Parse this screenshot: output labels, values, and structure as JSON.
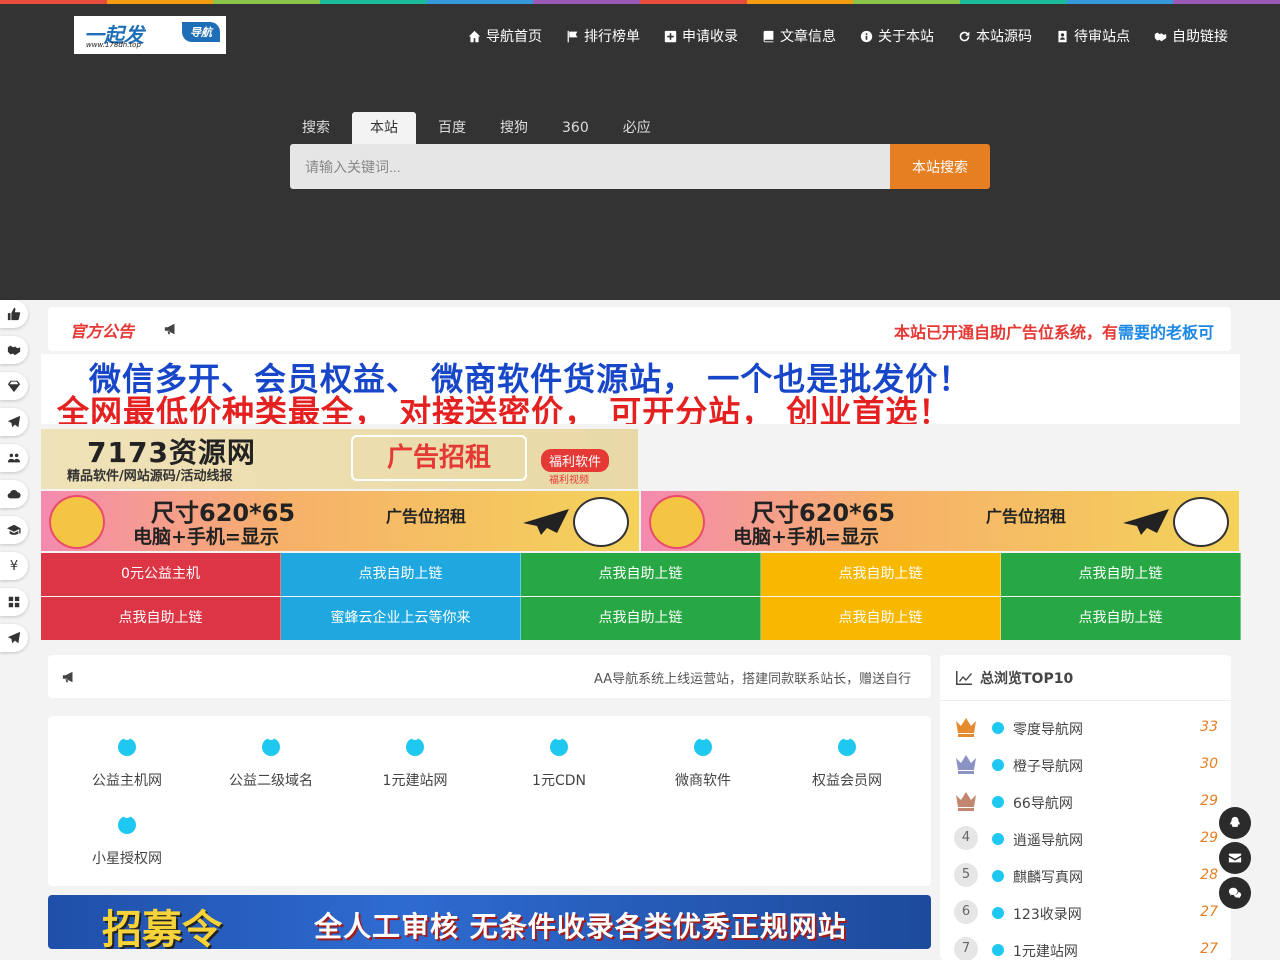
{
  "colors": {
    "rainbow": [
      "#e74c3c",
      "#f39c12",
      "#8bc34a",
      "#1abc9c",
      "#3498db",
      "#9b59b6",
      "#e74c3c",
      "#f39c12",
      "#8bc34a",
      "#1abc9c",
      "#3498db",
      "#9b59b6"
    ],
    "header_bg": "#333333",
    "accent": "#e67e22"
  },
  "logo": {
    "main": "一起发",
    "badge": "导航",
    "url": "www.178dh.top"
  },
  "nav": [
    {
      "label": "导航首页",
      "icon": "home-icon"
    },
    {
      "label": "排行榜单",
      "icon": "flag-icon"
    },
    {
      "label": "申请收录",
      "icon": "plus-square-icon"
    },
    {
      "label": "文章信息",
      "icon": "book-icon"
    },
    {
      "label": "关于本站",
      "icon": "info-icon"
    },
    {
      "label": "本站源码",
      "icon": "refresh-icon"
    },
    {
      "label": "待审站点",
      "icon": "user-card-icon"
    },
    {
      "label": "自助链接",
      "icon": "handshake-icon"
    }
  ],
  "search": {
    "tabs": [
      "搜索",
      "本站",
      "百度",
      "搜狗",
      "360",
      "必应"
    ],
    "active_tab": "本站",
    "placeholder": "请输入关键词...",
    "button": "本站搜索"
  },
  "sidebar": [
    "thumbs-up-icon",
    "handshake-icon",
    "diamond-icon",
    "paper-plane-icon",
    "users-icon",
    "cloud-icon",
    "graduation-cap-icon",
    "yen-icon",
    "grid-icon",
    "paper-plane-icon"
  ],
  "notice": {
    "title": "官方公告",
    "message_a": "本站已开通自助广告位系统，有",
    "message_b": "需要的老板可"
  },
  "ads": {
    "wide_line1": "微信多开、会员权益、 微商软件货源站， 一个也是批发价！",
    "wide_line2": "全网最低价种类最全， 对接送密价， 可开分站， 创业首选！",
    "res_title": "7173资源网",
    "res_sub": "精品软件/网站源码/活动线报",
    "res_rent": "广告招租",
    "res_tag1": "福利软件",
    "res_tag2": "福利视频",
    "size_text": "尺寸620*65",
    "device_text": "电脑+手机=显示",
    "rent_text": "广告位招租"
  },
  "link_grid": [
    {
      "label": "0元公益主机",
      "color": "red"
    },
    {
      "label": "点我自助上链",
      "color": "blue"
    },
    {
      "label": "点我自助上链",
      "color": "green"
    },
    {
      "label": "点我自助上链",
      "color": "yellow"
    },
    {
      "label": "点我自助上链",
      "color": "green"
    },
    {
      "label": "点我自助上链",
      "color": "red"
    },
    {
      "label": "蜜蜂云企业上云等你来",
      "color": "blue"
    },
    {
      "label": "点我自助上链",
      "color": "green"
    },
    {
      "label": "点我自助上链",
      "color": "yellow"
    },
    {
      "label": "点我自助上链",
      "color": "green"
    }
  ],
  "notice2": {
    "message": "AA导航系统上线运营站，搭建同款联系站长，赠送自行"
  },
  "sites": [
    "公益主机网",
    "公益二级域名",
    "1元建站网",
    "1元CDN",
    "微商软件",
    "权益会员网",
    "小星授权网"
  ],
  "banner": {
    "title": "招募令",
    "slogan": "全人工审核  无条件收录各类优秀正规网站"
  },
  "top10": {
    "title": "总浏览TOP10",
    "rows": [
      {
        "rank": "1",
        "name": "零度导航网",
        "count": "33",
        "medal": "gold"
      },
      {
        "rank": "2",
        "name": "橙子导航网",
        "count": "30",
        "medal": "silver"
      },
      {
        "rank": "3",
        "name": "66导航网",
        "count": "29",
        "medal": "bronze"
      },
      {
        "rank": "4",
        "name": "逍遥导航网",
        "count": "29"
      },
      {
        "rank": "5",
        "name": "麒麟写真网",
        "count": "28"
      },
      {
        "rank": "6",
        "name": "123收录网",
        "count": "27"
      },
      {
        "rank": "7",
        "name": "1元建站网",
        "count": "27"
      }
    ]
  },
  "float_buttons": [
    "qq-icon",
    "envelope-icon",
    "wechat-icon"
  ]
}
